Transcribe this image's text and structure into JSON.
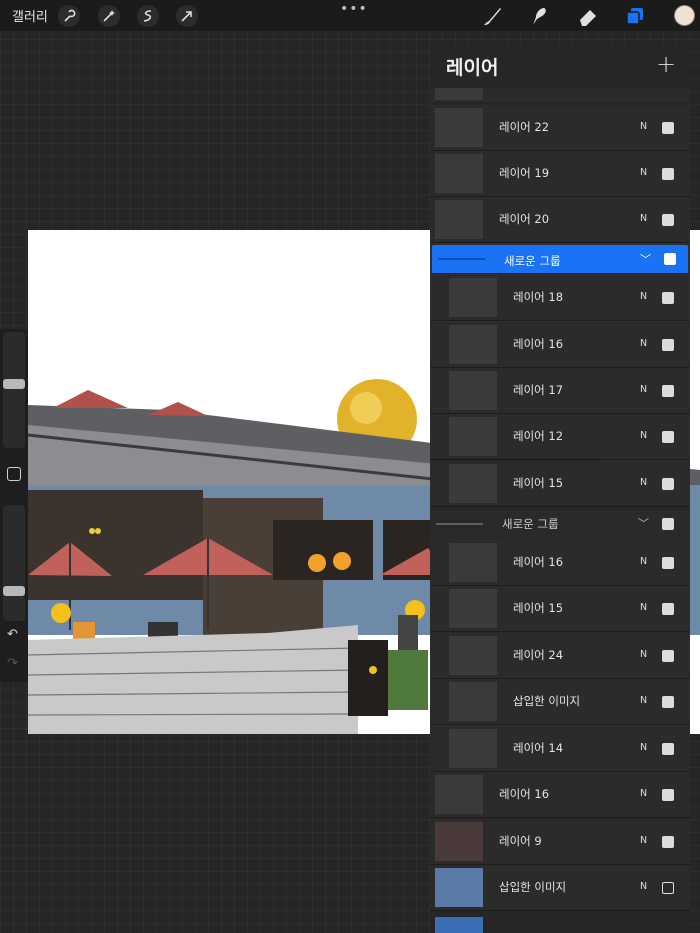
{
  "topbar": {
    "gallery_label": "갤러리",
    "tools_left": [
      "wrench-icon",
      "magic-wand-icon",
      "selection-icon",
      "transform-arrow-icon"
    ],
    "menu_dots": "•••",
    "tools_right": [
      "brush-icon",
      "smudge-icon",
      "eraser-icon",
      "layers-icon"
    ],
    "accent": "#1a73f5",
    "color_swatch": "#efe2d3"
  },
  "sidebar": {
    "undo": "↶",
    "redo": "↷"
  },
  "panel": {
    "title": "레이어",
    "add": "+",
    "rows": [
      {
        "name": "레이어 22",
        "mode": "N",
        "visible": true
      },
      {
        "name": "레이어 19",
        "mode": "N",
        "visible": true
      },
      {
        "name": "레이어 20",
        "mode": "N",
        "visible": true
      },
      {
        "name": "새로운 그룹",
        "group": true,
        "active": true,
        "visible": true
      },
      {
        "name": "레이어 18",
        "mode": "N",
        "visible": true
      },
      {
        "name": "레이어 16",
        "mode": "N",
        "visible": true
      },
      {
        "name": "레이어 17",
        "mode": "N",
        "visible": true
      },
      {
        "name": "레이어 12",
        "mode": "N",
        "visible": true
      },
      {
        "name": "레이어 15",
        "mode": "N",
        "visible": true
      },
      {
        "name": "새로운 그룹",
        "group": true,
        "active": false,
        "visible": true
      },
      {
        "name": "레이어 16",
        "mode": "N",
        "visible": true
      },
      {
        "name": "레이어 15",
        "mode": "N",
        "visible": true
      },
      {
        "name": "레이어 24",
        "mode": "N",
        "visible": true
      },
      {
        "name": "삽입한 이미지",
        "mode": "N",
        "visible": true
      },
      {
        "name": "레이어 14",
        "mode": "N",
        "visible": true
      },
      {
        "name": "레이어 16",
        "mode": "N",
        "visible": true
      },
      {
        "name": "레이어 9",
        "mode": "N",
        "visible": true
      },
      {
        "name": "삽입한 이미지",
        "mode": "N",
        "visible": false
      }
    ]
  }
}
